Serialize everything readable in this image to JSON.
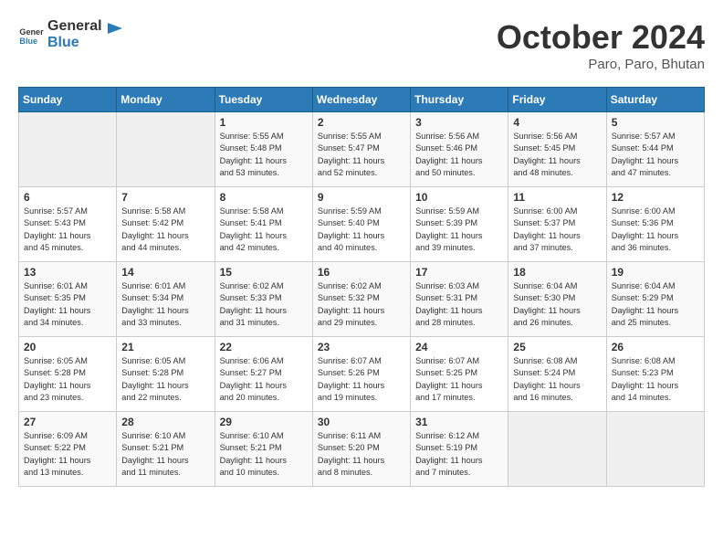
{
  "logo": {
    "text_general": "General",
    "text_blue": "Blue"
  },
  "title": "October 2024",
  "location": "Paro, Paro, Bhutan",
  "days_of_week": [
    "Sunday",
    "Monday",
    "Tuesday",
    "Wednesday",
    "Thursday",
    "Friday",
    "Saturday"
  ],
  "weeks": [
    [
      {
        "day": "",
        "info": ""
      },
      {
        "day": "",
        "info": ""
      },
      {
        "day": "1",
        "info": "Sunrise: 5:55 AM\nSunset: 5:48 PM\nDaylight: 11 hours\nand 53 minutes."
      },
      {
        "day": "2",
        "info": "Sunrise: 5:55 AM\nSunset: 5:47 PM\nDaylight: 11 hours\nand 52 minutes."
      },
      {
        "day": "3",
        "info": "Sunrise: 5:56 AM\nSunset: 5:46 PM\nDaylight: 11 hours\nand 50 minutes."
      },
      {
        "day": "4",
        "info": "Sunrise: 5:56 AM\nSunset: 5:45 PM\nDaylight: 11 hours\nand 48 minutes."
      },
      {
        "day": "5",
        "info": "Sunrise: 5:57 AM\nSunset: 5:44 PM\nDaylight: 11 hours\nand 47 minutes."
      }
    ],
    [
      {
        "day": "6",
        "info": "Sunrise: 5:57 AM\nSunset: 5:43 PM\nDaylight: 11 hours\nand 45 minutes."
      },
      {
        "day": "7",
        "info": "Sunrise: 5:58 AM\nSunset: 5:42 PM\nDaylight: 11 hours\nand 44 minutes."
      },
      {
        "day": "8",
        "info": "Sunrise: 5:58 AM\nSunset: 5:41 PM\nDaylight: 11 hours\nand 42 minutes."
      },
      {
        "day": "9",
        "info": "Sunrise: 5:59 AM\nSunset: 5:40 PM\nDaylight: 11 hours\nand 40 minutes."
      },
      {
        "day": "10",
        "info": "Sunrise: 5:59 AM\nSunset: 5:39 PM\nDaylight: 11 hours\nand 39 minutes."
      },
      {
        "day": "11",
        "info": "Sunrise: 6:00 AM\nSunset: 5:37 PM\nDaylight: 11 hours\nand 37 minutes."
      },
      {
        "day": "12",
        "info": "Sunrise: 6:00 AM\nSunset: 5:36 PM\nDaylight: 11 hours\nand 36 minutes."
      }
    ],
    [
      {
        "day": "13",
        "info": "Sunrise: 6:01 AM\nSunset: 5:35 PM\nDaylight: 11 hours\nand 34 minutes."
      },
      {
        "day": "14",
        "info": "Sunrise: 6:01 AM\nSunset: 5:34 PM\nDaylight: 11 hours\nand 33 minutes."
      },
      {
        "day": "15",
        "info": "Sunrise: 6:02 AM\nSunset: 5:33 PM\nDaylight: 11 hours\nand 31 minutes."
      },
      {
        "day": "16",
        "info": "Sunrise: 6:02 AM\nSunset: 5:32 PM\nDaylight: 11 hours\nand 29 minutes."
      },
      {
        "day": "17",
        "info": "Sunrise: 6:03 AM\nSunset: 5:31 PM\nDaylight: 11 hours\nand 28 minutes."
      },
      {
        "day": "18",
        "info": "Sunrise: 6:04 AM\nSunset: 5:30 PM\nDaylight: 11 hours\nand 26 minutes."
      },
      {
        "day": "19",
        "info": "Sunrise: 6:04 AM\nSunset: 5:29 PM\nDaylight: 11 hours\nand 25 minutes."
      }
    ],
    [
      {
        "day": "20",
        "info": "Sunrise: 6:05 AM\nSunset: 5:28 PM\nDaylight: 11 hours\nand 23 minutes."
      },
      {
        "day": "21",
        "info": "Sunrise: 6:05 AM\nSunset: 5:28 PM\nDaylight: 11 hours\nand 22 minutes."
      },
      {
        "day": "22",
        "info": "Sunrise: 6:06 AM\nSunset: 5:27 PM\nDaylight: 11 hours\nand 20 minutes."
      },
      {
        "day": "23",
        "info": "Sunrise: 6:07 AM\nSunset: 5:26 PM\nDaylight: 11 hours\nand 19 minutes."
      },
      {
        "day": "24",
        "info": "Sunrise: 6:07 AM\nSunset: 5:25 PM\nDaylight: 11 hours\nand 17 minutes."
      },
      {
        "day": "25",
        "info": "Sunrise: 6:08 AM\nSunset: 5:24 PM\nDaylight: 11 hours\nand 16 minutes."
      },
      {
        "day": "26",
        "info": "Sunrise: 6:08 AM\nSunset: 5:23 PM\nDaylight: 11 hours\nand 14 minutes."
      }
    ],
    [
      {
        "day": "27",
        "info": "Sunrise: 6:09 AM\nSunset: 5:22 PM\nDaylight: 11 hours\nand 13 minutes."
      },
      {
        "day": "28",
        "info": "Sunrise: 6:10 AM\nSunset: 5:21 PM\nDaylight: 11 hours\nand 11 minutes."
      },
      {
        "day": "29",
        "info": "Sunrise: 6:10 AM\nSunset: 5:21 PM\nDaylight: 11 hours\nand 10 minutes."
      },
      {
        "day": "30",
        "info": "Sunrise: 6:11 AM\nSunset: 5:20 PM\nDaylight: 11 hours\nand 8 minutes."
      },
      {
        "day": "31",
        "info": "Sunrise: 6:12 AM\nSunset: 5:19 PM\nDaylight: 11 hours\nand 7 minutes."
      },
      {
        "day": "",
        "info": ""
      },
      {
        "day": "",
        "info": ""
      }
    ]
  ]
}
